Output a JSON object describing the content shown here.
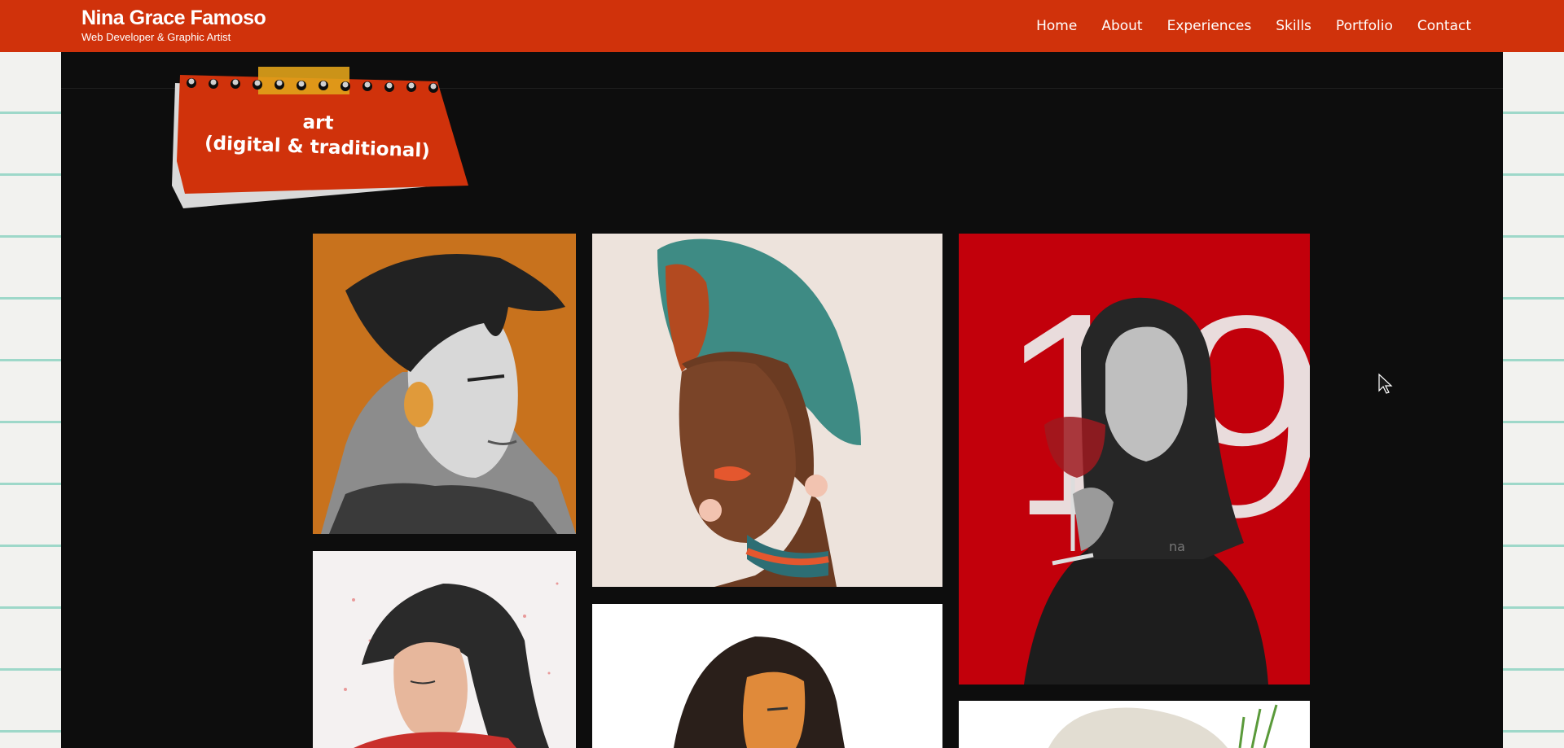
{
  "header": {
    "brand_name": "Nina Grace Famoso",
    "brand_subtitle": "Web Developer & Graphic Artist",
    "nav": [
      {
        "label": "Home"
      },
      {
        "label": "About"
      },
      {
        "label": "Experiences"
      },
      {
        "label": "Skills"
      },
      {
        "label": "Portfolio"
      },
      {
        "label": "Contact"
      }
    ]
  },
  "section": {
    "tag_line1": "art",
    "tag_line2": "(digital & traditional)"
  },
  "gallery": {
    "artworks": [
      {
        "name": "portrait-orange-boy",
        "background": "#c8721d"
      },
      {
        "name": "portrait-headwrap-woman",
        "background": "#ede3dc"
      },
      {
        "name": "portrait-wine-glass-19",
        "background": "#c2000b"
      },
      {
        "name": "watercolor-portrait",
        "background": "#f4f1f1"
      },
      {
        "name": "portrait-glow",
        "background": "#ffffff"
      },
      {
        "name": "portrait-cropped",
        "background": "#ffffff"
      }
    ]
  },
  "colors": {
    "accent": "#d0320b",
    "panel": "#0d0d0d",
    "paper_line": "#9ed8c9"
  }
}
